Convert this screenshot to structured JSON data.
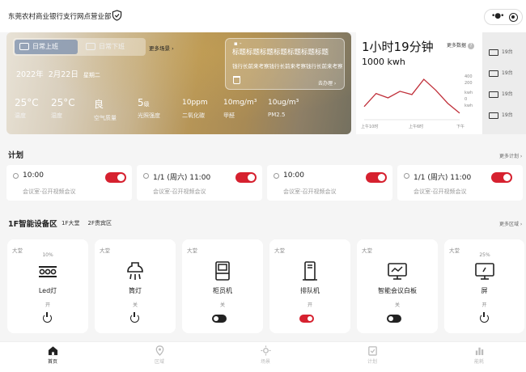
{
  "header": {
    "title": "东莞农村商业银行支行网点营业部"
  },
  "hero": {
    "modes": [
      {
        "label": "日常上班"
      },
      {
        "label": "日常下班"
      }
    ],
    "more_scene": "更多场景",
    "date": {
      "year": "2022年",
      "md": "2月22日",
      "weekday": "星期二"
    },
    "stats": [
      {
        "value": "25°C",
        "unit": "",
        "label": "温度"
      },
      {
        "value": "25°C",
        "unit": "",
        "label": "湿度"
      },
      {
        "value": "良",
        "unit": "",
        "label": "空气质量"
      },
      {
        "value": "5",
        "unit": "级",
        "label": "光照强度"
      },
      {
        "value": "10ppm",
        "unit": "",
        "label": "二氧化碳"
      },
      {
        "value": "10mg/m³",
        "unit": "",
        "label": "甲醛"
      },
      {
        "value": "10ug/m³",
        "unit": "",
        "label": "PM2.5"
      }
    ],
    "notice": {
      "title": "标题标题标题标题标题标题标题",
      "desc": "钱行长前来考察钱行长前来考察钱行长前来考察",
      "action": "去办理"
    }
  },
  "energy": {
    "duration": "1小时19分钟",
    "kwh": "1000 kwh",
    "more": "更多数据",
    "chart_data": {
      "type": "line",
      "x": [
        "上午10时",
        "",
        "",
        "上午6时",
        "",
        "",
        "下午"
      ],
      "values": [
        120,
        240,
        200,
        260,
        230,
        370,
        270,
        150,
        60
      ],
      "yticks": [
        "400",
        "200",
        "kwh",
        "0",
        "kwh"
      ],
      "color": "#c0303a"
    },
    "devices": [
      "19台",
      "19台",
      "19台",
      "19台"
    ]
  },
  "plan": {
    "title": "计划",
    "more": "更多计划",
    "items": [
      {
        "time": "10:00",
        "loc": "会议室-召开视频会议"
      },
      {
        "time": "1/1 (周六) 11:00",
        "loc": "会议室-召开视频会议"
      },
      {
        "time": "10:00",
        "loc": "会议室-召开视频会议"
      },
      {
        "time": "1/1 (周六) 11:00",
        "loc": "会议室-召开视频会议"
      }
    ]
  },
  "area": {
    "title": "1F智能设备区",
    "tabs": [
      "1F大堂",
      "2F贵宾区"
    ],
    "more": "更多区域",
    "devices": [
      {
        "tag": "大堂",
        "pct": "10%",
        "name": "Led灯",
        "state": "开",
        "icon": "led-icon",
        "control": "power"
      },
      {
        "tag": "大堂",
        "pct": "",
        "name": "筒灯",
        "state": "关",
        "icon": "downlight-icon",
        "control": "power"
      },
      {
        "tag": "大堂",
        "pct": "",
        "name": "柜员机",
        "state": "关",
        "icon": "atm-icon",
        "control": "toggle-off"
      },
      {
        "tag": "大堂",
        "pct": "",
        "name": "排队机",
        "state": "开",
        "icon": "queue-machine-icon",
        "control": "toggle-on"
      },
      {
        "tag": "大堂",
        "pct": "",
        "name": "智能会议白板",
        "state": "关",
        "icon": "whiteboard-icon",
        "control": "toggle-off"
      },
      {
        "tag": "大堂",
        "pct": "25%",
        "name": "屏",
        "state": "开",
        "icon": "screen-icon",
        "control": "power"
      }
    ]
  },
  "nav": [
    {
      "label": "首页",
      "icon": "home-icon"
    },
    {
      "label": "区域",
      "icon": "location-icon"
    },
    {
      "label": "场景",
      "icon": "scene-icon"
    },
    {
      "label": "计划",
      "icon": "plan-icon"
    },
    {
      "label": "能耗",
      "icon": "energy-icon"
    }
  ]
}
